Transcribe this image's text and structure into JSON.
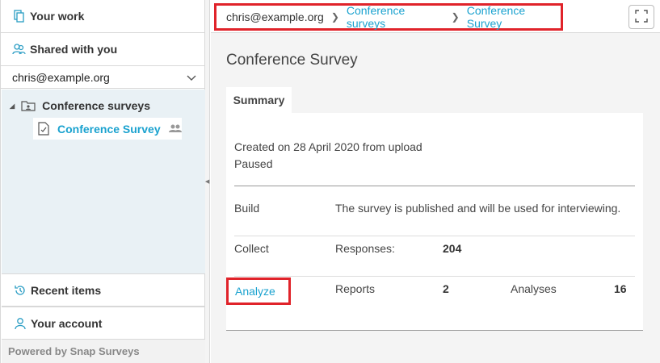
{
  "sidebar": {
    "your_work": "Your work",
    "shared_with_you": "Shared with you",
    "account_selected": "chris@example.org",
    "tree": {
      "folder": "Conference surveys",
      "survey": "Conference Survey"
    },
    "recent_items": "Recent items",
    "your_account": "Your account",
    "powered_by": "Powered by Snap Surveys"
  },
  "breadcrumb": {
    "root": "chris@example.org",
    "folder": "Conference surveys",
    "current": "Conference Survey"
  },
  "main": {
    "title": "Conference Survey",
    "tab_summary": "Summary",
    "created": "Created on 28 April 2020 from upload",
    "status": "Paused",
    "build": {
      "label": "Build",
      "text": "The survey is published and will be used for interviewing."
    },
    "collect": {
      "label": "Collect",
      "responses_label": "Responses:",
      "responses_value": "204"
    },
    "analyze": {
      "label": "Analyze",
      "reports_label": "Reports",
      "reports_value": "2",
      "analyses_label": "Analyses",
      "analyses_value": "16"
    }
  },
  "colors": {
    "accent": "#1aa2cf",
    "highlight": "#e0232a",
    "tree_bg": "#e9f1f5"
  }
}
